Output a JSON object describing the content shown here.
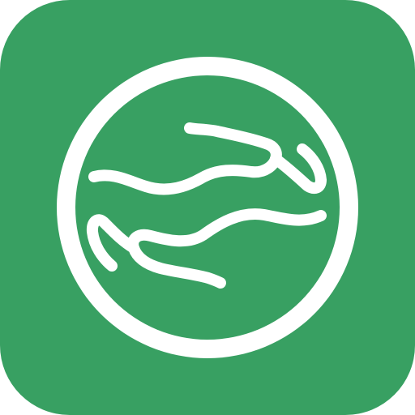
{
  "app_icon": {
    "name": "globe-hands-app-icon",
    "background_color": "#38a062",
    "foreground_color": "#ffffff"
  }
}
